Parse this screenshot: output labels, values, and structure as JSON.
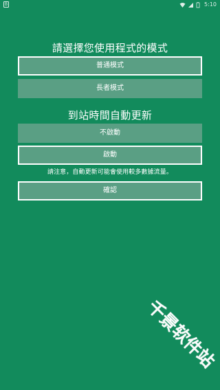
{
  "status_bar": {
    "left_badge": "B",
    "time": "5:10",
    "icons": [
      "wifi-icon",
      "signal-icon",
      "battery-icon"
    ]
  },
  "mode_section": {
    "title": "請選擇您使用程式的模式",
    "options": [
      {
        "label": "普通模式",
        "selected": true
      },
      {
        "label": "長者模式",
        "selected": false
      }
    ]
  },
  "auto_update_section": {
    "title": "到站時間自動更新",
    "options": [
      {
        "label": "不啟動",
        "selected": false
      },
      {
        "label": "啟動",
        "selected": true
      }
    ],
    "notice": "請注意，自動更新可能會使用較多數據流量。"
  },
  "actions": {
    "confirm_label": "確認"
  },
  "watermark": {
    "text": "千景软件站"
  },
  "colors": {
    "background": "#128b5c",
    "button": "#5a9f84",
    "text": "#ffffff"
  }
}
